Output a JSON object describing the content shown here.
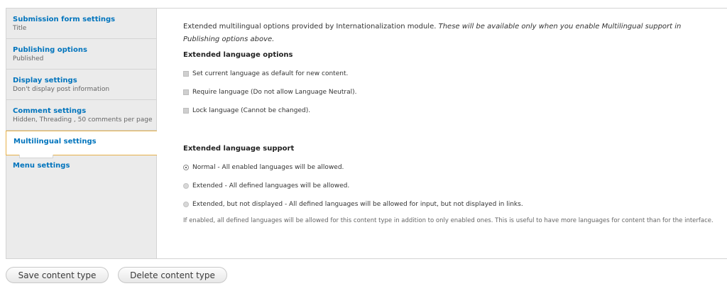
{
  "vertical_tabs": [
    {
      "title": "Submission form settings",
      "summary": "Title"
    },
    {
      "title": "Publishing options",
      "summary": "Published"
    },
    {
      "title": "Display settings",
      "summary": "Don't display post information"
    },
    {
      "title": "Comment settings",
      "summary": "Hidden, Threading , 50 comments per page"
    },
    {
      "title": "Multilingual settings",
      "summary": ""
    },
    {
      "title": "Menu settings",
      "summary": ""
    }
  ],
  "pane": {
    "description_plain": "Extended multilingual options provided by Internationalization module.",
    "description_italic": "These will be available only when you enable Multilingual support in Publishing options above.",
    "extended_options_title": "Extended language options",
    "checkboxes": [
      "Set current language as default for new content.",
      "Require language (Do not allow Language Neutral).",
      "Lock language (Cannot be changed)."
    ],
    "extended_support_title": "Extended language support",
    "radios": [
      "Normal - All enabled languages will be allowed.",
      "Extended - All defined languages will be allowed.",
      "Extended, but not displayed - All defined languages will be allowed for input, but not displayed in links."
    ],
    "radio_selected_index": 0,
    "help_text": "If enabled, all defined languages will be allowed for this content type in addition to only enabled ones. This is useful to have more languages for content than for the interface."
  },
  "buttons": {
    "save": "Save content type",
    "delete": "Delete content type"
  },
  "colors": {
    "link": "#0074bd",
    "active_tab_border": "#e6b14a",
    "tabs_background": "#ebebeb"
  }
}
